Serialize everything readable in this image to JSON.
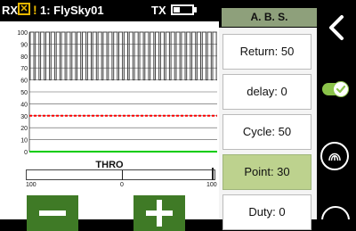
{
  "status": {
    "rx_label": "RX",
    "warn_glyph": "!",
    "model_name": "1: FlySky01",
    "tx_label": "TX"
  },
  "header": {
    "title": "A. B. S."
  },
  "chart": {
    "y_ticks": [
      "100",
      "90",
      "80",
      "70",
      "60",
      "50",
      "40",
      "30",
      "20",
      "10",
      "0"
    ],
    "pulse_count": 36,
    "pulse_high_percent": 100,
    "pulse_low_percent": 60,
    "threshold_percent": 30,
    "threshold_color": "#ff0000",
    "baseline_color": "#00cc00"
  },
  "throttle": {
    "label": "THRO",
    "scale_left": "100",
    "scale_mid": "0",
    "scale_right": "100"
  },
  "params": {
    "return_label": "Return: 50",
    "delay_label": "delay: 0",
    "cycle_label": "Cycle: 50",
    "point_label": "Point: 30",
    "duty_label": "Duty: 0"
  },
  "rail": {
    "back_icon": "chevron-left-icon",
    "toggle_icon": "toggle-on-icon",
    "toggle_color": "#8bc34a",
    "fingerprint_icon": "touch-icon"
  }
}
